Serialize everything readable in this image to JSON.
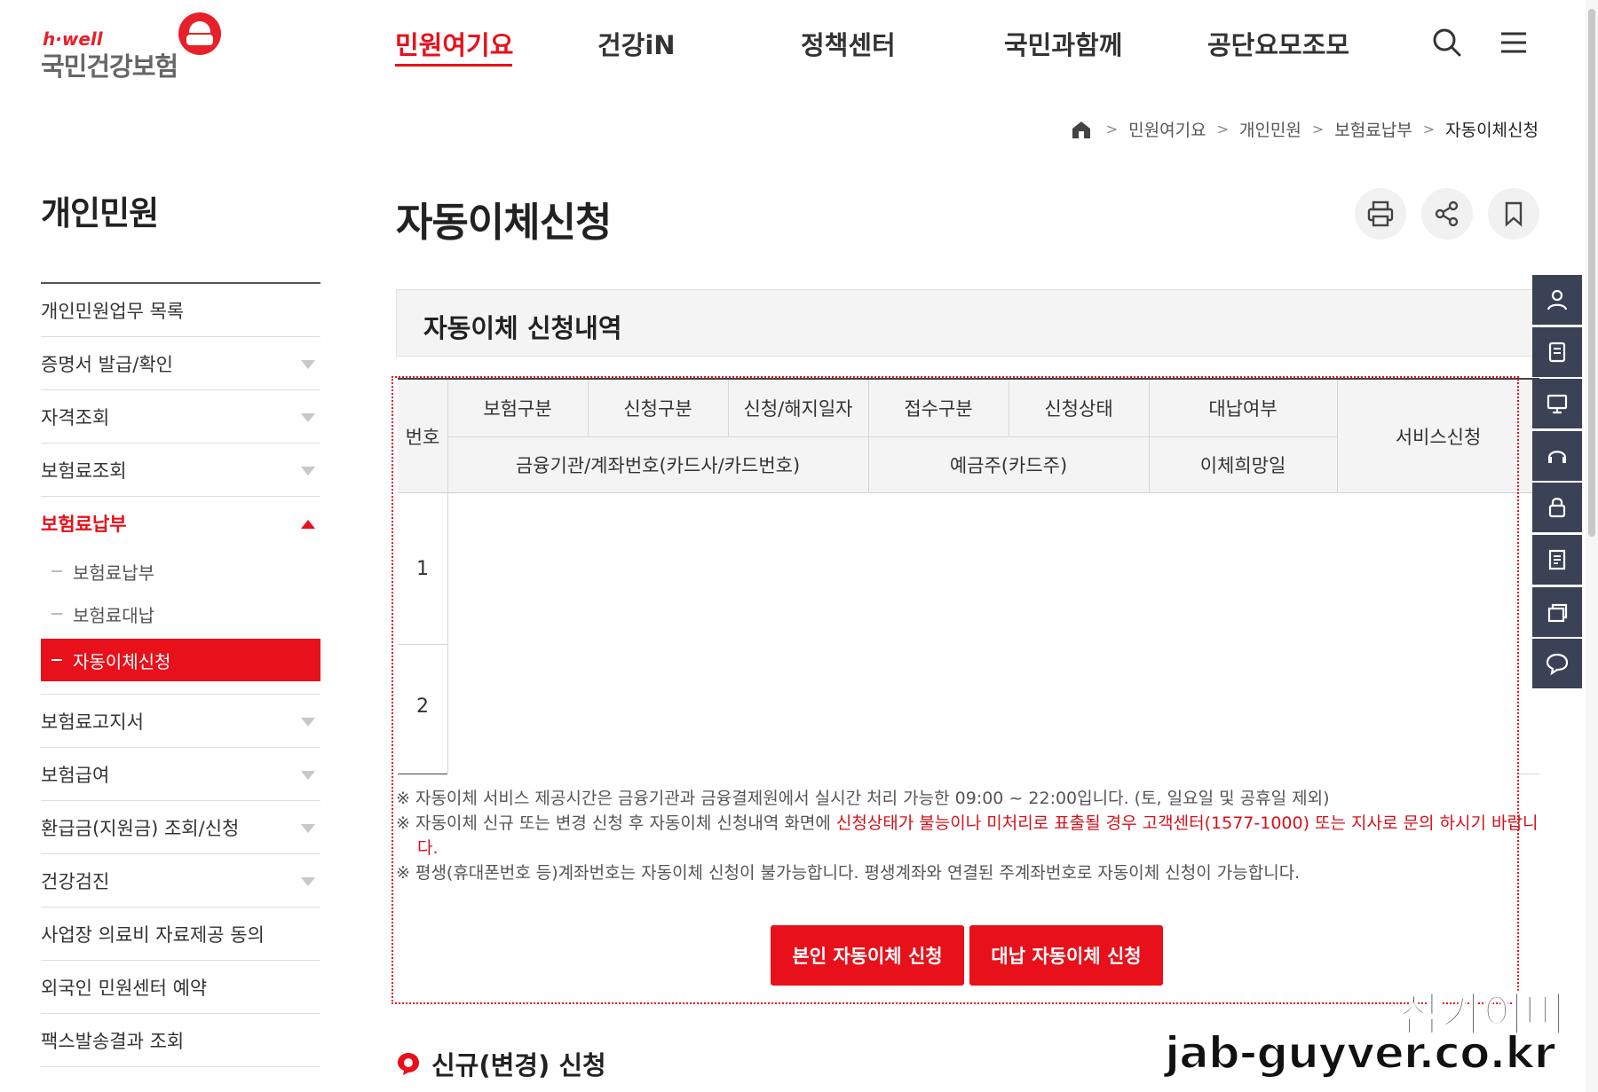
{
  "header": {
    "logo_small": "h·well",
    "logo_main": "국민건강보험",
    "nav": [
      "민원여기요",
      "건강iN",
      "정책센터",
      "국민과함께",
      "공단요모조모"
    ],
    "active_nav": "민원여기요"
  },
  "breadcrumb": [
    "민원여기요",
    "개인민원",
    "보험료납부",
    "자동이체신청"
  ],
  "sidebar": {
    "title": "개인민원",
    "items_top": [
      {
        "label": "개인민원업무 목록",
        "arrow": false
      },
      {
        "label": "증명서 발급/확인",
        "arrow": true
      },
      {
        "label": "자격조회",
        "arrow": true
      },
      {
        "label": "보험료조회",
        "arrow": true
      }
    ],
    "open_item": "보험료납부",
    "sub_items": [
      "보험료납부",
      "보험료대납",
      "자동이체신청"
    ],
    "items_bottom": [
      {
        "label": "보험료고지서",
        "arrow": true
      },
      {
        "label": "보험급여",
        "arrow": true
      },
      {
        "label": "환급금(지원금) 조회/신청",
        "arrow": true
      },
      {
        "label": "건강검진",
        "arrow": true
      },
      {
        "label": "사업장 의료비 자료제공 동의",
        "arrow": false
      },
      {
        "label": "외국인 민원센터 예약",
        "arrow": false
      },
      {
        "label": "팩스발송결과 조회",
        "arrow": false
      }
    ]
  },
  "page": {
    "title": "자동이체신청",
    "section_title": "자동이체 신청내역",
    "sub_heading": "신규(변경) 신청"
  },
  "table": {
    "header_no": "번호",
    "header_row1": [
      "보험구분",
      "신청구분",
      "신청/해지일자",
      "접수구분",
      "신청상태",
      "대납여부"
    ],
    "header_row2": [
      "금융기관/계좌번호(카드사/카드번호)",
      "예금주(카드주)",
      "이체희망일"
    ],
    "header_service": "서비스신청",
    "rows": [
      "1",
      "2"
    ]
  },
  "notes": {
    "note1": "※ 자동이체 서비스 제공시간은 금융기관과 금융결제원에서 실시간 처리 가능한 09:00 ~ 22:00입니다. (토, 일요일 및 공휴일 제외)",
    "note2_prefix": "※ 자동이체 신규 또는 변경 신청 후 자동이체 신청내역 화면에 ",
    "note2_red": "신청상태가 불능이나 미처리로 표출될 경우 고객센터(1577-1000) 또는 지사로 문의 하시기 바랍니",
    "note2_red_cont": "다.",
    "note3": "※ 평생(휴대폰번호 등)계좌번호는 자동이체 신청이 불가능합니다. 평생계좌와 연결된 주계좌번호로 자동이체 신청이 가능합니다."
  },
  "buttons": {
    "self": "본인 자동이체 신청",
    "proxy": "대납 자동이체 신청"
  },
  "icons": {
    "search": "search-icon",
    "menu": "hamburger-menu-icon",
    "print": "print-icon",
    "share": "share-icon",
    "bookmark": "bookmark-icon",
    "quick_menu": [
      "user-icon",
      "document-icon",
      "monitor-icon",
      "headset-icon",
      "lock-icon",
      "form-icon",
      "layers-icon",
      "chat-icon"
    ]
  },
  "colors": {
    "brand_red": "#e8101a",
    "quick_menu_bg": "#3b4255"
  },
  "watermark": {
    "line1": "잡가이버",
    "line2": "jab-guyver.co.kr"
  }
}
